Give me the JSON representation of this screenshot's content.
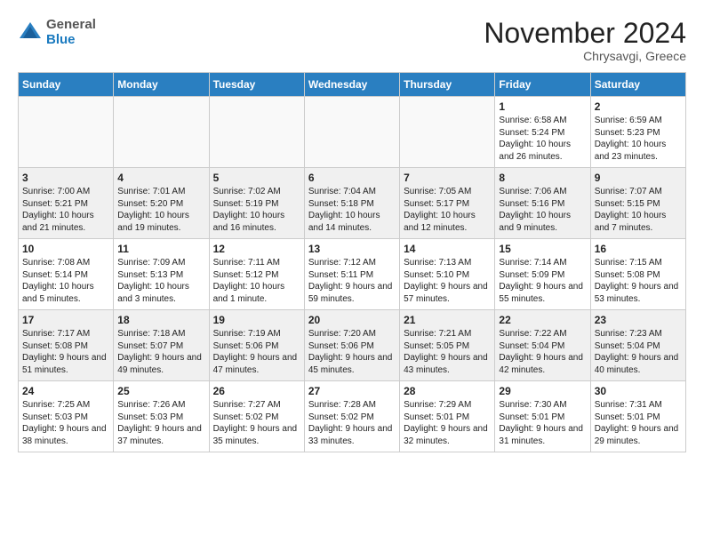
{
  "header": {
    "logo_general": "General",
    "logo_blue": "Blue",
    "month_title": "November 2024",
    "location": "Chrysavgi, Greece"
  },
  "days_of_week": [
    "Sunday",
    "Monday",
    "Tuesday",
    "Wednesday",
    "Thursday",
    "Friday",
    "Saturday"
  ],
  "weeks": [
    [
      {
        "day": "",
        "info": ""
      },
      {
        "day": "",
        "info": ""
      },
      {
        "day": "",
        "info": ""
      },
      {
        "day": "",
        "info": ""
      },
      {
        "day": "",
        "info": ""
      },
      {
        "day": "1",
        "info": "Sunrise: 6:58 AM\nSunset: 5:24 PM\nDaylight: 10 hours and 26 minutes."
      },
      {
        "day": "2",
        "info": "Sunrise: 6:59 AM\nSunset: 5:23 PM\nDaylight: 10 hours and 23 minutes."
      }
    ],
    [
      {
        "day": "3",
        "info": "Sunrise: 7:00 AM\nSunset: 5:21 PM\nDaylight: 10 hours and 21 minutes."
      },
      {
        "day": "4",
        "info": "Sunrise: 7:01 AM\nSunset: 5:20 PM\nDaylight: 10 hours and 19 minutes."
      },
      {
        "day": "5",
        "info": "Sunrise: 7:02 AM\nSunset: 5:19 PM\nDaylight: 10 hours and 16 minutes."
      },
      {
        "day": "6",
        "info": "Sunrise: 7:04 AM\nSunset: 5:18 PM\nDaylight: 10 hours and 14 minutes."
      },
      {
        "day": "7",
        "info": "Sunrise: 7:05 AM\nSunset: 5:17 PM\nDaylight: 10 hours and 12 minutes."
      },
      {
        "day": "8",
        "info": "Sunrise: 7:06 AM\nSunset: 5:16 PM\nDaylight: 10 hours and 9 minutes."
      },
      {
        "day": "9",
        "info": "Sunrise: 7:07 AM\nSunset: 5:15 PM\nDaylight: 10 hours and 7 minutes."
      }
    ],
    [
      {
        "day": "10",
        "info": "Sunrise: 7:08 AM\nSunset: 5:14 PM\nDaylight: 10 hours and 5 minutes."
      },
      {
        "day": "11",
        "info": "Sunrise: 7:09 AM\nSunset: 5:13 PM\nDaylight: 10 hours and 3 minutes."
      },
      {
        "day": "12",
        "info": "Sunrise: 7:11 AM\nSunset: 5:12 PM\nDaylight: 10 hours and 1 minute."
      },
      {
        "day": "13",
        "info": "Sunrise: 7:12 AM\nSunset: 5:11 PM\nDaylight: 9 hours and 59 minutes."
      },
      {
        "day": "14",
        "info": "Sunrise: 7:13 AM\nSunset: 5:10 PM\nDaylight: 9 hours and 57 minutes."
      },
      {
        "day": "15",
        "info": "Sunrise: 7:14 AM\nSunset: 5:09 PM\nDaylight: 9 hours and 55 minutes."
      },
      {
        "day": "16",
        "info": "Sunrise: 7:15 AM\nSunset: 5:08 PM\nDaylight: 9 hours and 53 minutes."
      }
    ],
    [
      {
        "day": "17",
        "info": "Sunrise: 7:17 AM\nSunset: 5:08 PM\nDaylight: 9 hours and 51 minutes."
      },
      {
        "day": "18",
        "info": "Sunrise: 7:18 AM\nSunset: 5:07 PM\nDaylight: 9 hours and 49 minutes."
      },
      {
        "day": "19",
        "info": "Sunrise: 7:19 AM\nSunset: 5:06 PM\nDaylight: 9 hours and 47 minutes."
      },
      {
        "day": "20",
        "info": "Sunrise: 7:20 AM\nSunset: 5:06 PM\nDaylight: 9 hours and 45 minutes."
      },
      {
        "day": "21",
        "info": "Sunrise: 7:21 AM\nSunset: 5:05 PM\nDaylight: 9 hours and 43 minutes."
      },
      {
        "day": "22",
        "info": "Sunrise: 7:22 AM\nSunset: 5:04 PM\nDaylight: 9 hours and 42 minutes."
      },
      {
        "day": "23",
        "info": "Sunrise: 7:23 AM\nSunset: 5:04 PM\nDaylight: 9 hours and 40 minutes."
      }
    ],
    [
      {
        "day": "24",
        "info": "Sunrise: 7:25 AM\nSunset: 5:03 PM\nDaylight: 9 hours and 38 minutes."
      },
      {
        "day": "25",
        "info": "Sunrise: 7:26 AM\nSunset: 5:03 PM\nDaylight: 9 hours and 37 minutes."
      },
      {
        "day": "26",
        "info": "Sunrise: 7:27 AM\nSunset: 5:02 PM\nDaylight: 9 hours and 35 minutes."
      },
      {
        "day": "27",
        "info": "Sunrise: 7:28 AM\nSunset: 5:02 PM\nDaylight: 9 hours and 33 minutes."
      },
      {
        "day": "28",
        "info": "Sunrise: 7:29 AM\nSunset: 5:01 PM\nDaylight: 9 hours and 32 minutes."
      },
      {
        "day": "29",
        "info": "Sunrise: 7:30 AM\nSunset: 5:01 PM\nDaylight: 9 hours and 31 minutes."
      },
      {
        "day": "30",
        "info": "Sunrise: 7:31 AM\nSunset: 5:01 PM\nDaylight: 9 hours and 29 minutes."
      }
    ]
  ]
}
